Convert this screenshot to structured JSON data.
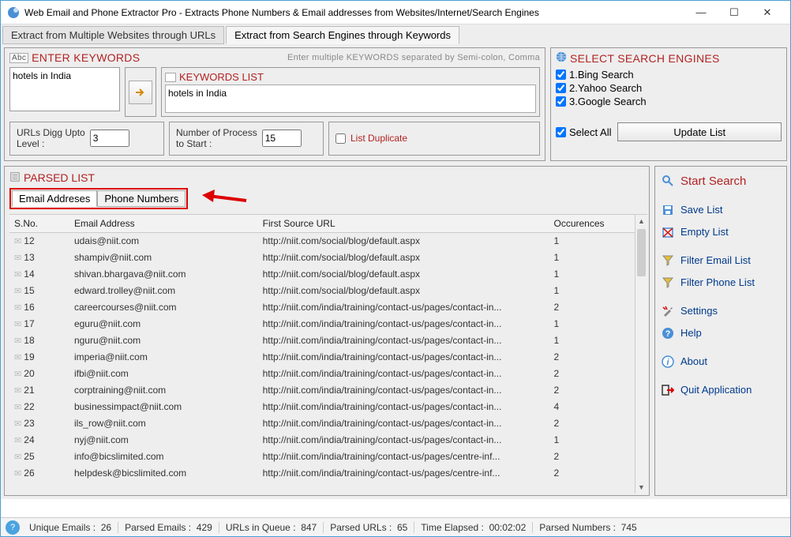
{
  "window": {
    "title": "Web Email and Phone Extractor Pro - Extracts Phone Numbers & Email addresses from Websites/Internet/Search Engines"
  },
  "tabs": {
    "urls": "Extract from Multiple Websites through URLs",
    "keywords": "Extract from Search Engines through Keywords"
  },
  "keywords_panel": {
    "title": "ENTER KEYWORDS",
    "hint": "Enter multiple KEYWORDS separated by Semi-colon, Comma",
    "input_value": "hotels in India",
    "list_title": "KEYWORDS LIST",
    "list_value": "hotels in India"
  },
  "options": {
    "digg_label": "URLs Digg Upto\nLevel :",
    "digg_value": "3",
    "proc_label": "Number of Process\nto Start :",
    "proc_value": "15",
    "list_dup": "List Duplicate"
  },
  "search_engines": {
    "title": "SELECT SEARCH ENGINES",
    "items": [
      "1.Bing Search",
      "2.Yahoo Search",
      "3.Google Search"
    ],
    "select_all": "Select All",
    "update_btn": "Update List"
  },
  "parsed": {
    "title": "PARSED LIST",
    "tab_email": "Email Addreses",
    "tab_phone": "Phone Numbers",
    "columns": {
      "sno": "S.No.",
      "email": "Email Address",
      "url": "First Source URL",
      "occ": "Occurences"
    },
    "rows": [
      {
        "sno": "12",
        "email": "udais@niit.com",
        "url": "http://niit.com/social/blog/default.aspx",
        "occ": "1"
      },
      {
        "sno": "13",
        "email": "shampiv@niit.com",
        "url": "http://niit.com/social/blog/default.aspx",
        "occ": "1"
      },
      {
        "sno": "14",
        "email": "shivan.bhargava@niit.com",
        "url": "http://niit.com/social/blog/default.aspx",
        "occ": "1"
      },
      {
        "sno": "15",
        "email": "edward.trolley@niit.com",
        "url": "http://niit.com/social/blog/default.aspx",
        "occ": "1"
      },
      {
        "sno": "16",
        "email": "careercourses@niit.com",
        "url": "http://niit.com/india/training/contact-us/pages/contact-in...",
        "occ": "2"
      },
      {
        "sno": "17",
        "email": "eguru@niit.com",
        "url": "http://niit.com/india/training/contact-us/pages/contact-in...",
        "occ": "1"
      },
      {
        "sno": "18",
        "email": "nguru@niit.com",
        "url": "http://niit.com/india/training/contact-us/pages/contact-in...",
        "occ": "1"
      },
      {
        "sno": "19",
        "email": "imperia@niit.com",
        "url": "http://niit.com/india/training/contact-us/pages/contact-in...",
        "occ": "2"
      },
      {
        "sno": "20",
        "email": "ifbi@niit.com",
        "url": "http://niit.com/india/training/contact-us/pages/contact-in...",
        "occ": "2"
      },
      {
        "sno": "21",
        "email": "corptraining@niit.com",
        "url": "http://niit.com/india/training/contact-us/pages/contact-in...",
        "occ": "2"
      },
      {
        "sno": "22",
        "email": "businessimpact@niit.com",
        "url": "http://niit.com/india/training/contact-us/pages/contact-in...",
        "occ": "4"
      },
      {
        "sno": "23",
        "email": "ils_row@niit.com",
        "url": "http://niit.com/india/training/contact-us/pages/contact-in...",
        "occ": "2"
      },
      {
        "sno": "24",
        "email": "nyj@niit.com",
        "url": "http://niit.com/india/training/contact-us/pages/contact-in...",
        "occ": "1"
      },
      {
        "sno": "25",
        "email": "info@bicslimited.com",
        "url": "http://niit.com/india/training/contact-us/pages/centre-inf...",
        "occ": "2"
      },
      {
        "sno": "26",
        "email": "helpdesk@bicslimited.com",
        "url": "http://niit.com/india/training/contact-us/pages/centre-inf...",
        "occ": "2"
      }
    ]
  },
  "sidebar": {
    "start": "Start Search",
    "save": "Save List",
    "empty": "Empty List",
    "filter_email": "Filter Email List",
    "filter_phone": "Filter Phone List",
    "settings": "Settings",
    "help": "Help",
    "about": "About",
    "quit": "Quit Application"
  },
  "status": {
    "unique_emails_label": "Unique Emails :",
    "unique_emails": "26",
    "parsed_emails_label": "Parsed Emails :",
    "parsed_emails": "429",
    "urls_queue_label": "URLs in Queue :",
    "urls_queue": "847",
    "parsed_urls_label": "Parsed URLs :",
    "parsed_urls": "65",
    "elapsed_label": "Time Elapsed :",
    "elapsed": "00:02:02",
    "parsed_numbers_label": "Parsed Numbers :",
    "parsed_numbers": "745"
  }
}
